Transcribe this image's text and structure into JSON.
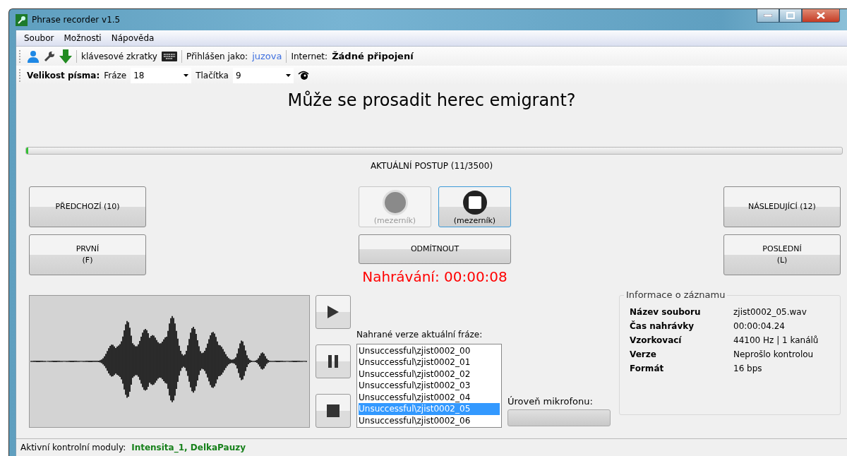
{
  "window": {
    "title": "Phrase recorder v1.5"
  },
  "menu": [
    "Soubor",
    "Možnosti",
    "Nápověda"
  ],
  "toolbar": {
    "shortcuts_label": "klávesové zkratky",
    "login_label": "Přihlášen jako:",
    "user": "juzova",
    "internet_label": "Internet:",
    "internet_status": "Žádné připojení"
  },
  "font_size": {
    "label": "Velikost písma:",
    "phrase_label": "Fráze",
    "phrase_value": "18",
    "buttons_label": "Tlačítka",
    "buttons_value": "9"
  },
  "phrase": "Může se prosadit herec emigrant?",
  "progress": {
    "level": 0.003,
    "label": "AKTUÁLNÍ POSTUP (11/3500)"
  },
  "nav_left": [
    {
      "lines": [
        "PŘEDCHOZÍ (10)"
      ]
    },
    {
      "lines": [
        "PRVNÍ",
        "(F)"
      ]
    }
  ],
  "nav_right": [
    {
      "lines": [
        "NÁSLEDUJÍCÍ (12)"
      ]
    },
    {
      "lines": [
        "POSLEDNÍ",
        "(L)"
      ]
    }
  ],
  "record_buttons": [
    {
      "kind": "record",
      "caption": "(mezerník)",
      "disabled": true
    },
    {
      "kind": "stop",
      "caption": "(mezerník)",
      "disabled": false
    }
  ],
  "reject_button": "ODMÍTNOUT",
  "recording_status": "Nahrávání: 00:00:08",
  "versions": {
    "label": "Nahrané verze aktuální fráze:",
    "items": [
      {
        "text": "Unsuccessful\\zjist0002_00",
        "selected": false
      },
      {
        "text": "Unsuccessful\\zjist0002_01",
        "selected": false
      },
      {
        "text": "Unsuccessful\\zjist0002_02",
        "selected": false
      },
      {
        "text": "Unsuccessful\\zjist0002_03",
        "selected": false
      },
      {
        "text": "Unsuccessful\\zjist0002_04",
        "selected": false
      },
      {
        "text": "Unsuccessful\\zjist0002_05",
        "selected": true
      },
      {
        "text": "Unsuccessful\\zjist0002_06",
        "selected": false
      }
    ]
  },
  "mic": {
    "label": "Úroveň mikrofonu:"
  },
  "info": {
    "title": "Informace o záznamu",
    "rows": [
      {
        "label": "Název souboru",
        "value": "zjist0002_05.wav"
      },
      {
        "label": "Čas nahrávky",
        "value": "00:00:04.24"
      },
      {
        "label": "Vzorkovací",
        "value": "44100 Hz | 1 kanálů"
      },
      {
        "label": "Verze",
        "value": "Neprošlo kontrolou"
      },
      {
        "label": "Formát",
        "value": "16 bps"
      }
    ]
  },
  "status_bar": {
    "label": "Aktivní kontrolní moduly:",
    "modules": "Intensita_1, DelkaPauzy"
  }
}
